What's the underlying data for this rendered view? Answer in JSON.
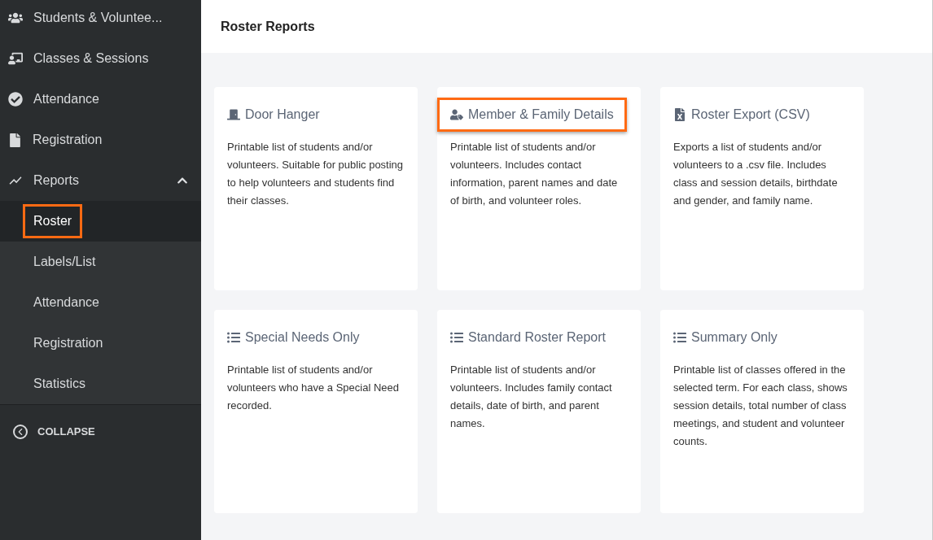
{
  "sidebar": {
    "items": [
      {
        "label": "Students & Voluntee...",
        "kind": "people"
      },
      {
        "label": "Classes & Sessions",
        "kind": "classroom"
      },
      {
        "label": "Attendance",
        "kind": "check"
      },
      {
        "label": "Registration",
        "kind": "file"
      },
      {
        "label": "Reports",
        "kind": "chart",
        "expanded": true,
        "children": [
          {
            "label": "Roster",
            "selected": true,
            "highlighted": true
          },
          {
            "label": "Labels/List",
            "selected": false,
            "highlighted": false
          },
          {
            "label": "Attendance",
            "selected": false,
            "highlighted": false
          },
          {
            "label": "Registration",
            "selected": false,
            "highlighted": false
          },
          {
            "label": "Statistics",
            "selected": false,
            "highlighted": false
          }
        ]
      }
    ],
    "collapse": "COLLAPSE"
  },
  "page_title": "Roster Reports",
  "cards": [
    {
      "title": "Door Hanger",
      "kind": "door",
      "highlighted": false,
      "description": "Printable list of students and/or volunteers. Suitable for public posting to help volunteers and students find their classes."
    },
    {
      "title": "Member & Family Details",
      "kind": "member",
      "highlighted": true,
      "description": "Printable list of students and/or volunteers. Includes contact information, parent names and date of birth, and volunteer roles."
    },
    {
      "title": "Roster Export (CSV)",
      "kind": "csv",
      "highlighted": false,
      "description": "Exports a list of students and/or volunteers to a .csv file. Includes class and session details, birthdate and gender, and family name."
    },
    {
      "title": "Special Needs Only",
      "kind": "list",
      "highlighted": false,
      "description": "Printable list of students and/or volunteers who have a Special Need recorded."
    },
    {
      "title": "Standard Roster Report",
      "kind": "list",
      "highlighted": false,
      "description": "Printable list of students and/or volunteers. Includes family contact details, date of birth, and parent names."
    },
    {
      "title": "Summary Only",
      "kind": "list",
      "highlighted": false,
      "description": "Printable list of classes offered in the selected term. For each class, shows session details, total number of class meetings, and student and volunteer counts."
    }
  ]
}
